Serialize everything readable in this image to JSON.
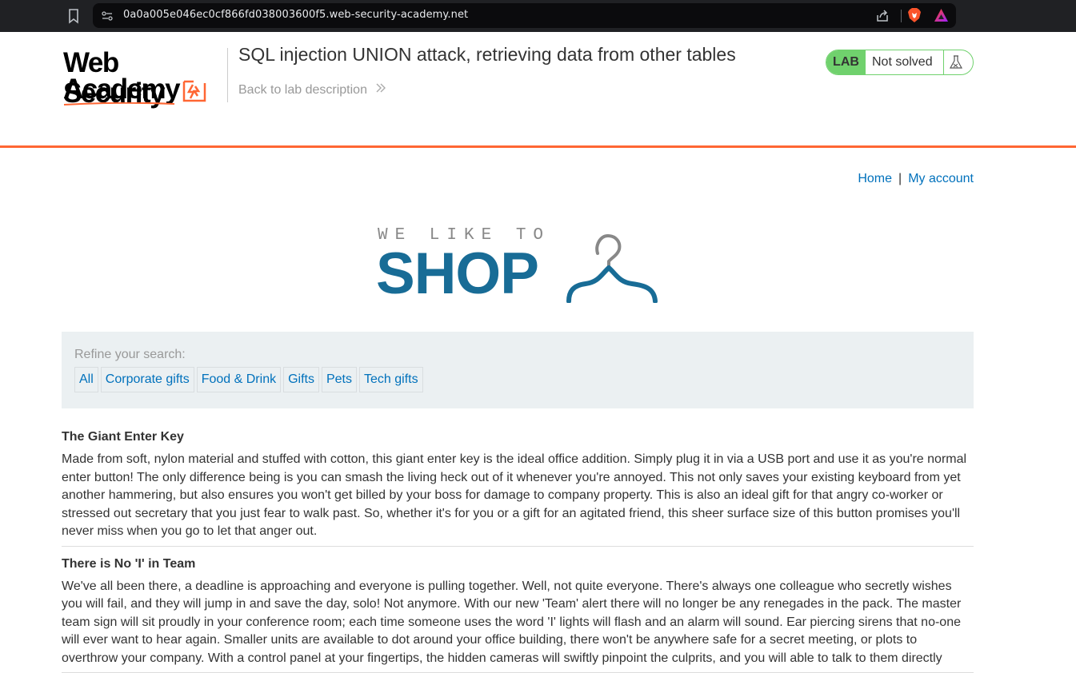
{
  "browser": {
    "url": "0a0a005e046ec0cf866fd038003600f5.web-security-academy.net",
    "icons": [
      "bookmark-icon",
      "site-info-icon",
      "share-icon",
      "brave-icon",
      "rewards-icon"
    ]
  },
  "academy_header": {
    "logo_line1": "Web Security",
    "logo_line2": "Academy",
    "lab_title": "SQL injection UNION attack, retrieving data from other tables",
    "back_link": "Back to lab description",
    "badge_label": "LAB",
    "badge_status": "Not solved",
    "colors": {
      "accent": "#ff6633",
      "badge_green": "#70d16d",
      "link": "#0071bc"
    }
  },
  "shop": {
    "nav": {
      "home": "Home",
      "separator": "|",
      "account": "My account"
    },
    "banner": {
      "small": "WE LIKE TO",
      "big": "SHOP",
      "brand_color": "#186c96"
    },
    "filter": {
      "label": "Refine your search:",
      "categories": [
        "All",
        "Corporate gifts",
        "Food & Drink",
        "Gifts",
        "Pets",
        "Tech gifts"
      ]
    },
    "products": [
      {
        "title": "The Giant Enter Key",
        "description": "Made from soft, nylon material and stuffed with cotton, this giant enter key is the ideal office addition. Simply plug it in via a USB port and use it as you're normal enter button! The only difference being is you can smash the living heck out of it whenever you're annoyed. This not only saves your existing keyboard from yet another hammering, but also ensures you won't get billed by your boss for damage to company property. This is also an ideal gift for that angry co-worker or stressed out secretary that you just fear to walk past. So, whether it's for you or a gift for an agitated friend, this sheer surface size of this button promises you'll never miss when you go to let that anger out."
      },
      {
        "title": "There is No 'I' in Team",
        "description": "We've all been there, a deadline is approaching and everyone is pulling together. Well, not quite everyone. There's always one colleague who secretly wishes you will fail, and they will jump in and save the day, solo! Not anymore. With our new 'Team' alert there will no longer be any renegades in the pack. The master team sign will sit proudly in your conference room; each time someone uses the word 'I' lights will flash and an alarm will sound. Ear piercing sirens that no-one will ever want to hear again. Smaller units are available to dot around your office building, there won't be anywhere safe for a secret meeting, or plots to overthrow your company. With a control panel at your fingertips, the hidden cameras will swiftly pinpoint the culprits, and you will able to talk to them directly"
      }
    ]
  }
}
